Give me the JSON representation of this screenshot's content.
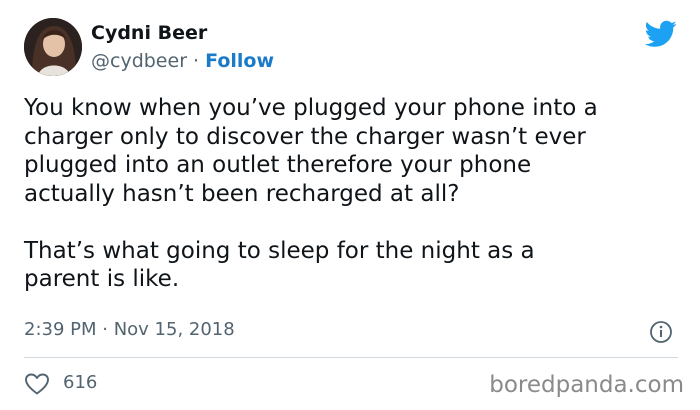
{
  "author": {
    "name": "Cydni Beer",
    "handle": "@cydbeer",
    "separator": " · ",
    "follow_label": "Follow"
  },
  "tweet": {
    "lines_paragraph_1": [
      "You know when you’ve plugged your phone into a",
      "charger only to discover the charger wasn’t ever",
      "plugged into an outlet therefore your phone",
      "actually hasn’t been recharged at all?"
    ],
    "lines_paragraph_2": [
      "That’s what going to sleep for the night as a",
      "parent is like."
    ],
    "timestamp": "2:39 PM · Nov 15, 2018"
  },
  "engagement": {
    "like_count": "616"
  },
  "watermark": "boredpanda.com",
  "colors": {
    "twitter_blue": "#1da1f2",
    "follow_blue": "#1b7bc8",
    "text_primary": "#0f1419",
    "text_secondary": "#536471",
    "divider": "#cfd9de"
  },
  "icons": {
    "brand": "twitter-bird-icon",
    "info": "info-icon",
    "like": "heart-icon"
  }
}
